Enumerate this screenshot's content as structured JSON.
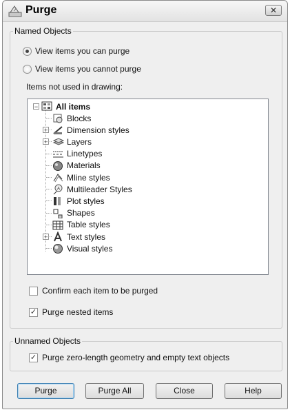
{
  "window": {
    "title": "Purge",
    "close_glyph": "✕"
  },
  "named_objects": {
    "label": "Named Objects",
    "radio_can_purge": "View items you can purge",
    "radio_cannot_purge": "View items you cannot purge",
    "selected": "can_purge",
    "items_label": "Items not used in drawing:",
    "tree": {
      "root": "All items",
      "items": [
        {
          "label": "Blocks",
          "icon": "blocks-icon",
          "expandable": false
        },
        {
          "label": "Dimension styles",
          "icon": "dimension-styles-icon",
          "expandable": true
        },
        {
          "label": "Layers",
          "icon": "layers-icon",
          "expandable": true
        },
        {
          "label": "Linetypes",
          "icon": "linetypes-icon",
          "expandable": false
        },
        {
          "label": "Materials",
          "icon": "materials-icon",
          "expandable": false
        },
        {
          "label": "Mline styles",
          "icon": "mline-styles-icon",
          "expandable": false
        },
        {
          "label": "Multileader Styles",
          "icon": "multileader-styles-icon",
          "expandable": false
        },
        {
          "label": "Plot styles",
          "icon": "plot-styles-icon",
          "expandable": false
        },
        {
          "label": "Shapes",
          "icon": "shapes-icon",
          "expandable": false
        },
        {
          "label": "Table styles",
          "icon": "table-styles-icon",
          "expandable": false
        },
        {
          "label": "Text styles",
          "icon": "text-styles-icon",
          "expandable": true
        },
        {
          "label": "Visual styles",
          "icon": "visual-styles-icon",
          "expandable": false
        }
      ]
    },
    "confirm_label": "Confirm each item to be purged",
    "confirm_checked": false,
    "nested_label": "Purge nested items",
    "nested_checked": true
  },
  "unnamed_objects": {
    "label": "Unnamed Objects",
    "zero_length_label": "Purge zero-length geometry and empty text objects",
    "zero_length_checked": true
  },
  "buttons": {
    "purge": "Purge",
    "purge_all": "Purge All",
    "close": "Close",
    "help": "Help"
  }
}
